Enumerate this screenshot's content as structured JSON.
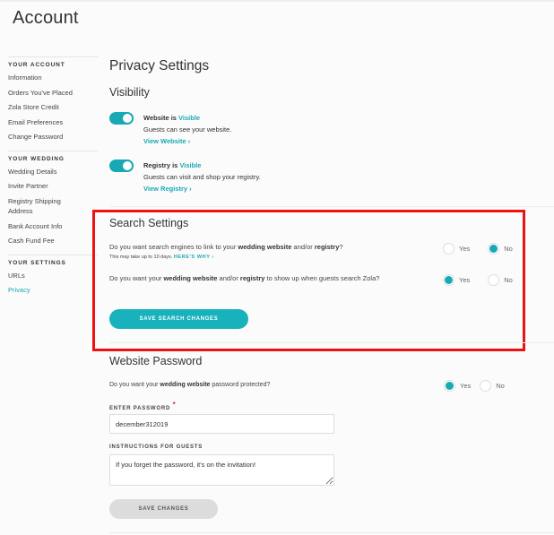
{
  "page": {
    "title": "Account"
  },
  "sidebar": {
    "groups": [
      {
        "heading": "YOUR ACCOUNT",
        "items": [
          "Information",
          "Orders You've Placed",
          "Zola Store Credit",
          "Email Preferences",
          "Change Password"
        ]
      },
      {
        "heading": "YOUR WEDDING",
        "items": [
          "Wedding Details",
          "Invite Partner",
          "Registry Shipping Address",
          "Bank Account Info",
          "Cash Fund Fee"
        ]
      },
      {
        "heading": "YOUR SETTINGS",
        "items": [
          "URLs",
          "Privacy"
        ]
      }
    ],
    "active_item": "Privacy"
  },
  "privacy": {
    "title": "Privacy Settings",
    "visibility": {
      "title": "Visibility",
      "website": {
        "label_prefix": "Website is ",
        "state": "Visible",
        "description": "Guests can see your website.",
        "link": "View Website ›",
        "enabled": true
      },
      "registry": {
        "label_prefix": "Registry is ",
        "state": "Visible",
        "description": "Guests can visit and shop your registry.",
        "link": "View Registry ›",
        "enabled": true
      }
    },
    "search": {
      "title": "Search Settings",
      "q1": {
        "p1": "Do you want search engines to link to your ",
        "b1": "wedding website",
        "p2": " and/or ",
        "b2": "registry",
        "p3": "?",
        "note": "This may take up to 10 days. ",
        "note_link": "HERE'S WHY ›",
        "yes": "Yes",
        "no": "No",
        "selected": "No"
      },
      "q2": {
        "p1": "Do you want your ",
        "b1": "wedding website",
        "p2": " and/or ",
        "b2": "registry",
        "p3": " to show up when guests search Zola?",
        "yes": "Yes",
        "no": "No",
        "selected": "Yes"
      },
      "save_label": "SAVE SEARCH CHANGES"
    },
    "password": {
      "title": "Website Password",
      "q": {
        "p1": "Do you want your ",
        "b1": "wedding website",
        "p2": " password protected?",
        "yes": "Yes",
        "no": "No",
        "selected": "Yes"
      },
      "password_label": "ENTER PASSWORD",
      "required_mark": "*",
      "password_value": "december312019",
      "instructions_label": "INSTRUCTIONS FOR GUESTS",
      "instructions_value": "If you forget the password, it's on the invitation!",
      "save_label": "SAVE CHANGES"
    }
  },
  "colors": {
    "accent": "#18a9b4",
    "highlight_box": "#ee1111"
  }
}
